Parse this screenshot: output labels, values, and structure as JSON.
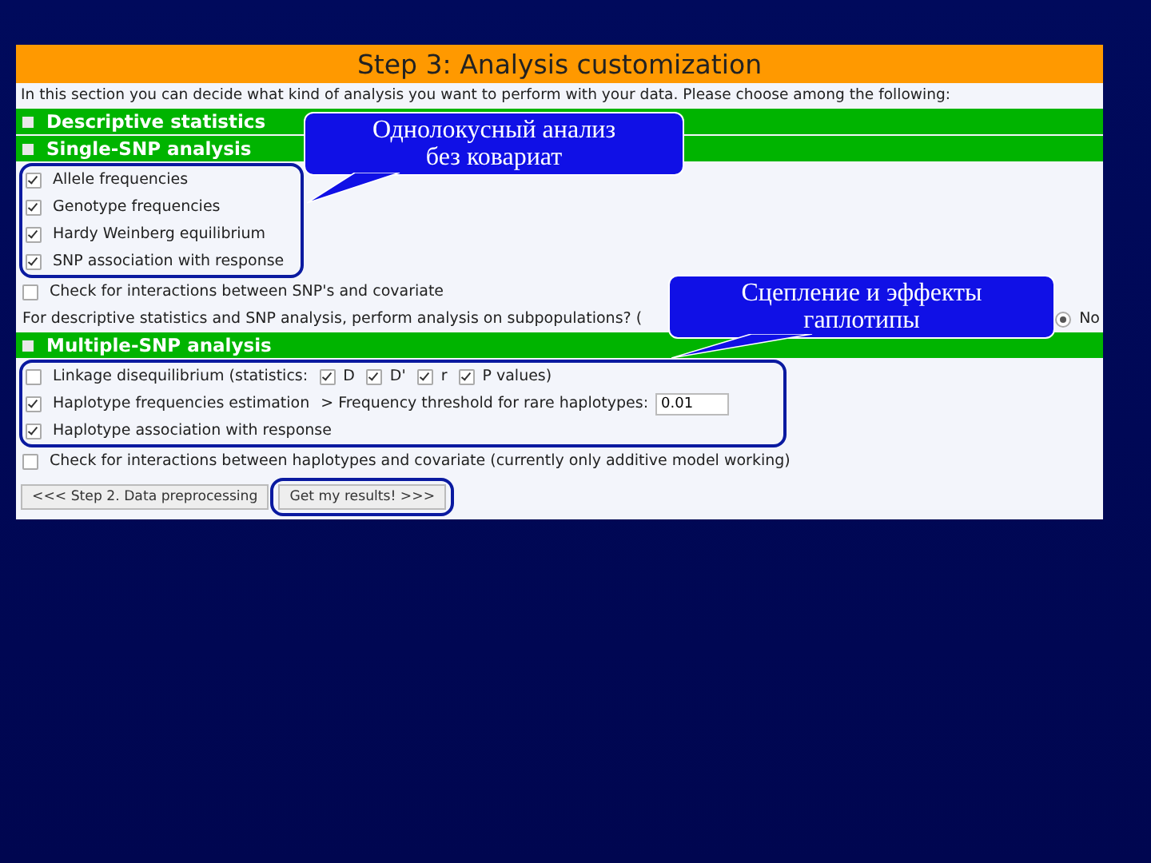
{
  "title": "Step 3: Analysis customization",
  "intro": "In this section you can decide what kind of analysis you want to perform with your data. Please choose among the following:",
  "sections": [
    {
      "heading": "Descriptive statistics"
    },
    {
      "heading": "Single-SNP analysis",
      "options": [
        {
          "label": "Allele frequencies",
          "checked": true
        },
        {
          "label": "Genotype frequencies",
          "checked": true
        },
        {
          "label": "Hardy Weinberg equilibrium",
          "checked": true
        },
        {
          "label": "SNP association with response",
          "checked": true
        }
      ],
      "extra": {
        "label": "Check for interactions between SNP's and covariate",
        "checked": false
      }
    }
  ],
  "subpopulations": {
    "question": "For descriptive statistics and SNP analysis, perform analysis on subpopulations? (",
    "no": {
      "label": "No",
      "selected": true
    }
  },
  "multiple": {
    "heading": "Multiple-SNP analysis",
    "linkage": {
      "label": "Linkage disequilibrium (statistics:",
      "checked": false,
      "stats": [
        {
          "label": "D",
          "checked": true
        },
        {
          "label": "D'",
          "checked": true
        },
        {
          "label": "r",
          "checked": true
        },
        {
          "label": "P values",
          "checked": true
        }
      ],
      "suffix": ")"
    },
    "haplo_freq": {
      "label": "Haplotype frequencies estimation",
      "checked": true,
      "threshold_label": "> Frequency threshold for rare haplotypes:",
      "threshold_value": "0.01"
    },
    "haplo_assoc": {
      "label": "Haplotype association with response",
      "checked": true
    },
    "extra": {
      "label": "Check for interactions between haplotypes and covariate (currently only additive model working)",
      "checked": false
    }
  },
  "buttons": [
    "<<< Step 2. Data preprocessing",
    "Get my results! >>>"
  ],
  "callouts": [
    {
      "lines": [
        "Однолокусный анализ",
        "без ковариат"
      ]
    },
    {
      "lines": [
        "Сцепление и эффекты",
        "гаплотипы"
      ]
    }
  ]
}
